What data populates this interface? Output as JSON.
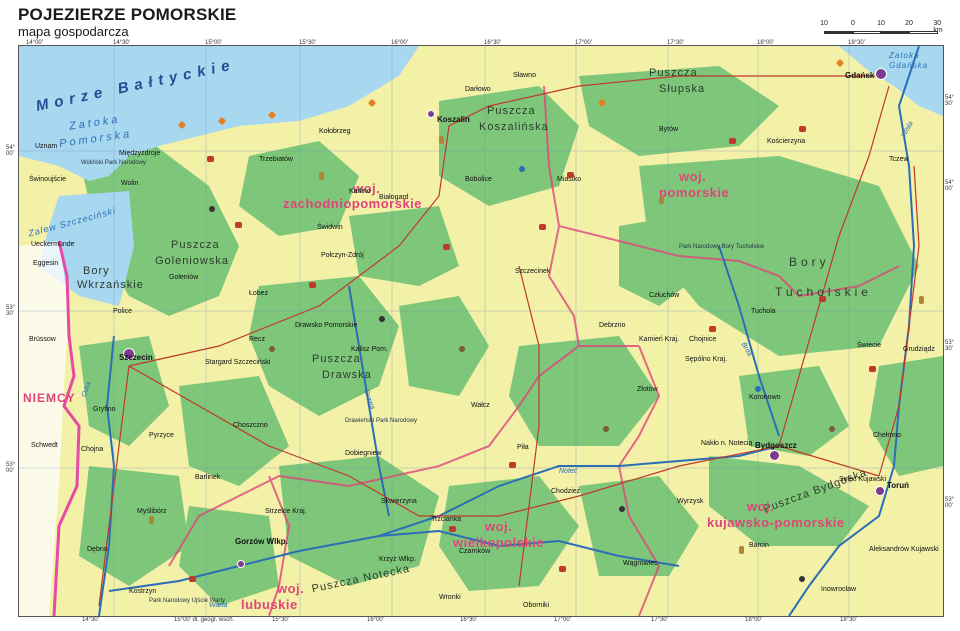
{
  "title": "POJEZIERZE POMORSKIE",
  "subtitle": "mapa gospodarcza",
  "scale": {
    "ticks": [
      "10",
      "0",
      "10",
      "20",
      "30 km"
    ]
  },
  "graticule": {
    "top": [
      "14°00'",
      "14°30'",
      "15°00'",
      "15°30'",
      "16°00'",
      "16°30'",
      "17°00'",
      "17°30'",
      "18°00'",
      "18°30'"
    ],
    "bottom": [
      "14°30'",
      "15°00' dł. geogr. wsch.",
      "15°30'",
      "16°00'",
      "16°30'",
      "17°00'",
      "17°30'",
      "18°00'",
      "18°30'"
    ],
    "left": [
      "54° 00'",
      "53° 30'",
      "53° 00'"
    ],
    "right": [
      "54° 30'",
      "54° 00'",
      "53° 30'",
      "53° 00'"
    ]
  },
  "water": {
    "sea": "Morze Bałtyckie",
    "bay": [
      "Zatoka",
      "Pomorska"
    ],
    "gdansk_bay": [
      "Zatoka",
      "Gdańska"
    ],
    "lagoon": "Zalew Szczeciński"
  },
  "forests": {
    "slupska": [
      "Puszcza",
      "Słupska"
    ],
    "koszalinska": [
      "Puszcza",
      "Koszalińska"
    ],
    "goleniowska": [
      "Puszcza",
      "Goleniowska"
    ],
    "wkrzanskie": [
      "Bory",
      "Wkrzańskie"
    ],
    "drawska": [
      "Puszcza",
      "Drawska"
    ],
    "tucholskie": [
      "Bory",
      "Tucholskie"
    ],
    "bydgoska": "Puszcza Bydgoska",
    "notecka": "Puszcza Notecka"
  },
  "regions": {
    "zachodniopomorskie": [
      "woj.",
      "zachodniopomorskie"
    ],
    "pomorskie": [
      "woj.",
      "pomorskie"
    ],
    "kujawsko": [
      "woj.",
      "kujawsko-pomorskie"
    ],
    "wielkopolskie": [
      "woj.",
      "wielkopolskie"
    ],
    "lubuskie": [
      "woj.",
      "lubuskie"
    ]
  },
  "country": "NIEMCY",
  "major_cities": {
    "gdansk": "Gdańsk",
    "koszalin": "Koszalin",
    "szczecin": "Szczecin",
    "bydgoszcz": "Bydgoszcz",
    "torun": "Toruń",
    "gorzow": "Gorzów Wlkp."
  },
  "towns": {
    "uznam": "Uznam",
    "swinoujscie": "Świnoujście",
    "wolin": "Wolin",
    "miedzyzdroje": "Międzyzdroje",
    "ueckermunde": "Ueckermünde",
    "police": "Police",
    "goleniow": "Goleniów",
    "stargard": "Stargard Szczeciński",
    "pyrzyce": "Pyrzyce",
    "mysliborz": "Myślibórz",
    "kostrzyn": "Kostrzyn",
    "choszczno": "Choszczno",
    "drawsko": "Drawsko Pomorskie",
    "walcz": "Wałcz",
    "pila": "Piła",
    "szczecinek": "Szczecinek",
    "bialogard": "Białogard",
    "kolobrzeg": "Kołobrzeg",
    "darlowo": "Darłowo",
    "slawno": "Sławno",
    "bytow": "Bytów",
    "chojnice": "Chojnice",
    "czluchow": "Człuchów",
    "tuchola": "Tuchola",
    "swiecie": "Świecie",
    "grudziadz": "Grudziądz",
    "chelmno": "Chełmno",
    "naklo": "Nakło n. Notecią",
    "inowroclaw": "Inowrocław",
    "wrzesnia": "Wągrowiec",
    "czarnkow": "Czarnków",
    "trzcianka": "Trzcianka",
    "chodziez": "Chodzież",
    "tczew": "Tczew",
    "koscierzyna": "Kościerzyna",
    "wejherowo": "Złotów",
    "sulecin": "Skwierzyna",
    "dobiegniew": "Dobiegniew",
    "barlinek": "Barlinek",
    "strzelce": "Strzelce Kraj.",
    "debno": "Dębno",
    "chojna": "Chojna",
    "gryfino": "Gryfino",
    "schwedt": "Schwedt",
    "brussow": "Brüssow",
    "eggesin": "Eggesin",
    "polczyn": "Połczyn-Zdrój",
    "swidwin": "Świdwin",
    "lobez": "Łobez",
    "recz": "Recz",
    "kalisz": "Kalisz Pom.",
    "trzebiatow": "Trzebiatów",
    "karlino": "Karlino",
    "bobolice": "Bobolice",
    "miastko": "Miastko",
    "debrzno": "Debrzno",
    "kamien": "Kamień Kraj.",
    "sepolno": "Sępólno Kraj.",
    "koronowo": "Koronowo",
    "solec": "Solec Kujawski",
    "aleksandrow": "Aleksandrów Kujawski",
    "barcin": "Barcin",
    "wyrzysk": "Wyrzysk",
    "krzyz": "Krzyż Wlkp.",
    "wronki": "Wronki",
    "obrzycko": "Oborniki"
  },
  "rivers": {
    "odra": "Odra",
    "warta": "Warta",
    "notec": "Noteć",
    "wisla": "Wisła",
    "drawa": "Drawa",
    "brda": "Brda"
  },
  "parks": {
    "wolinski": "Woliński Park Narodowy",
    "drawienski": "Drawieński Park Narodowy",
    "borytucholskie": "Park Narodowy Bory Tucholskie",
    "ujscie": "Park Narodowy Ujście Warty"
  },
  "colors": {
    "sea": "#a8d8f0",
    "lowland": "#f3f0a8",
    "forest": "#7ec77a",
    "region_border": "#e0457a",
    "country_border": "#e64aa6",
    "river": "#2a6fb5",
    "road": "#c0392b",
    "city": "#7a3c8c"
  },
  "icons": [
    "cattle-icon",
    "pig-icon",
    "corn-icon",
    "potato-icon",
    "industry-icon",
    "fish-icon",
    "tourism-icon",
    "wind-icon"
  ]
}
